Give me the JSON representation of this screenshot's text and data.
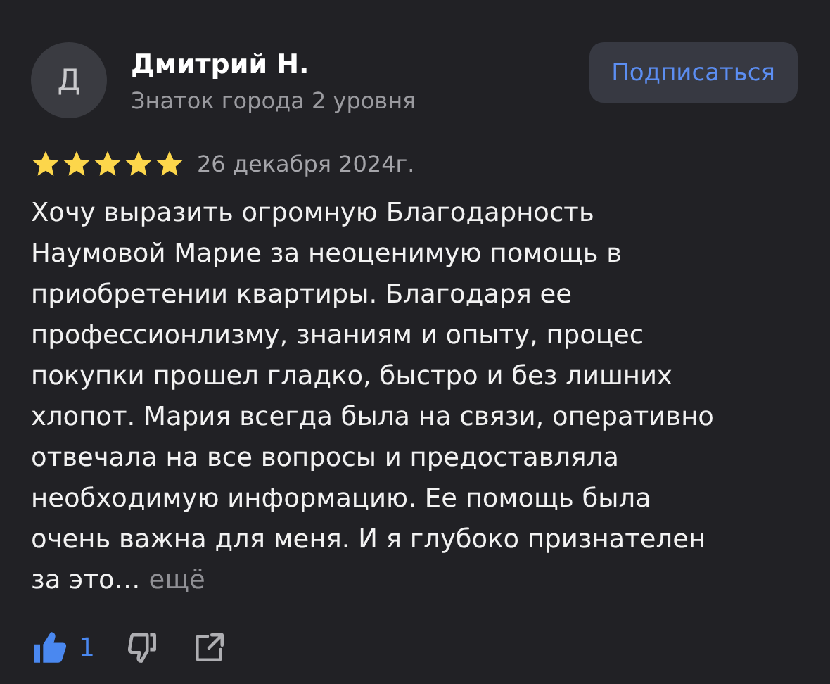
{
  "author": {
    "initial": "Д",
    "name": "Дмитрий Н.",
    "level": "Знаток города 2 уровня"
  },
  "subscribe_button": "Подписаться",
  "review": {
    "stars": 5,
    "date": "26 декабря 2024г.",
    "text": "Хочу выразить огромную Благодарность\nНаумовой Марие за неоценимую помощь в\nприобретении квартиры. Благодаря ее\nпрофессионлизму, знаниям и опыту, процес\nпокупки прошел гладко, быстро и без лишних\nхлопот. Мария всегда была на связи, оперативно\nотвечала на все вопросы и предоставляла\nнеобходимую информацию. Ее помощь была\nочень важна для меня. И я глубоко признателен\nза это…",
    "more_link": "ещё"
  },
  "actions": {
    "like": {
      "liked": true,
      "count": "1"
    },
    "dislike": {
      "disliked": false
    }
  }
}
